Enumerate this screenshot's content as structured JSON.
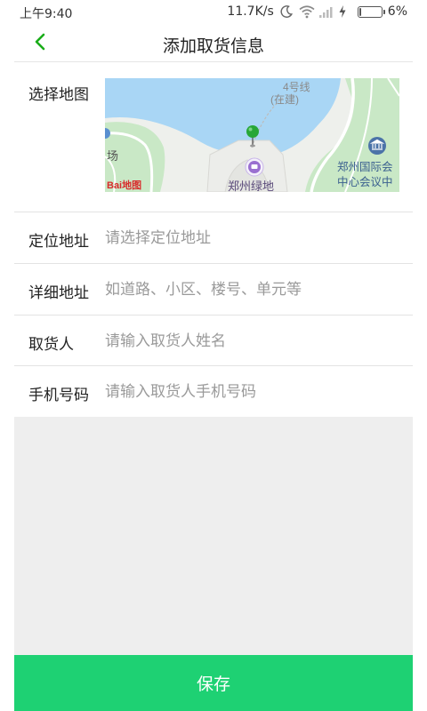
{
  "status_bar": {
    "time": "上午9:40",
    "network_speed": "11.7K/s",
    "battery": "6%",
    "battery_level": 0.06,
    "icons": [
      "moon-icon",
      "wifi-icon",
      "signal-icon",
      "charging-icon",
      "battery-icon"
    ]
  },
  "header": {
    "title": "添加取货信息",
    "back_icon": "chevron-left-icon"
  },
  "form": {
    "map": {
      "label": "选择地图",
      "map_labels": {
        "metro": "4号线",
        "metro_status": "(在建)",
        "plaza": "场",
        "center_line1": "郑州国际会",
        "center_line2": "中心会议中",
        "landmark": "郑州绿地"
      },
      "logo": "Bai地图"
    },
    "address": {
      "label": "定位地址",
      "placeholder": "请选择定位地址"
    },
    "detail": {
      "label": "详细地址",
      "placeholder": "如道路、小区、楼号、单元等"
    },
    "name": {
      "label": "取货人",
      "placeholder": "请输入取货人姓名"
    },
    "phone": {
      "label": "手机号码",
      "placeholder": "请输入取货人手机号码"
    }
  },
  "actions": {
    "save_label": "保存"
  },
  "colors": {
    "accent": "#1ed173",
    "back_arrow": "#1aad19",
    "water": "#a9d6f5",
    "park": "#c9e8c6",
    "pin": "#27a737"
  }
}
